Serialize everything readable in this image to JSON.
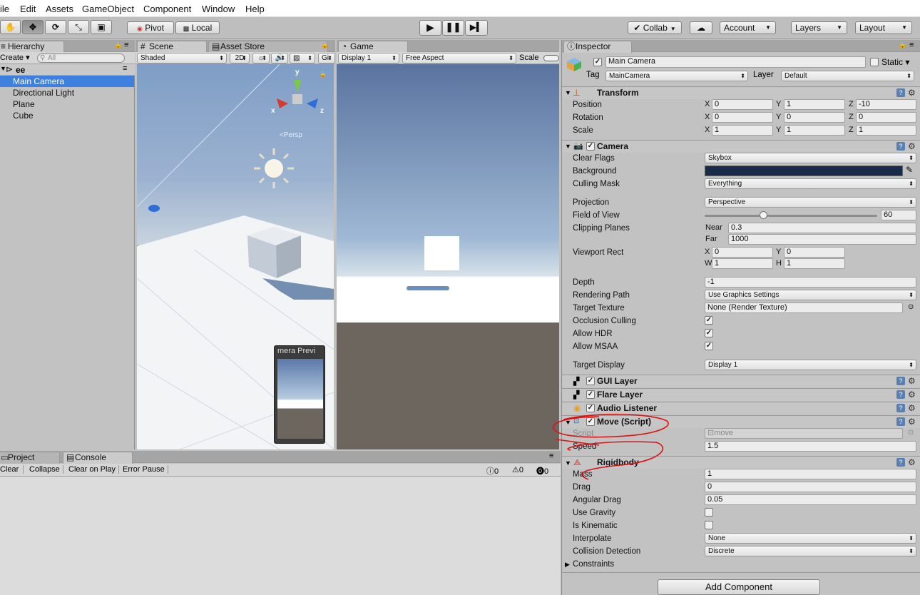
{
  "menu": [
    "ile",
    "Edit",
    "Assets",
    "GameObject",
    "Component",
    "Window",
    "Help"
  ],
  "toolbar": {
    "pivot_label": "Pivot",
    "local_label": "Local",
    "collab_label": "Collab",
    "account_label": "Account",
    "layers_label": "Layers",
    "layout_label": "Layout"
  },
  "hierarchy": {
    "tab_label": "Hierarchy",
    "create_label": "Create",
    "search_placeholder": "All",
    "scene_name": "ee",
    "items": [
      "Main Camera",
      "Directional Light",
      "Plane",
      "Cube"
    ]
  },
  "scene": {
    "tab_label": "Scene",
    "asset_store_label": "Asset Store",
    "shaded_label": "Shaded",
    "twod_label": "2D",
    "gizmos_label": "Gi",
    "persp_label": "Persp",
    "axis_x": "x",
    "axis_y": "y",
    "axis_z": "z",
    "camera_preview_label": "mera Previ"
  },
  "game": {
    "tab_label": "Game",
    "display_label": "Display 1",
    "aspect_label": "Free Aspect",
    "scale_label": "Scale"
  },
  "console": {
    "project_tab": "Project",
    "console_tab": "Console",
    "clear": "Clear",
    "collapse": "Collapse",
    "clear_on_play": "Clear on Play",
    "error_pause": "Error Pause",
    "info_count": "0",
    "warn_count": "0",
    "error_count": "0"
  },
  "inspector": {
    "tab_label": "Inspector",
    "object_name": "Main Camera",
    "static_label": "Static",
    "tag_label": "Tag",
    "tag_value": "MainCamera",
    "layer_label": "Layer",
    "layer_value": "Default",
    "transform": {
      "title": "Transform",
      "position_label": "Position",
      "rotation_label": "Rotation",
      "scale_label": "Scale",
      "position": [
        "0",
        "1",
        "-10"
      ],
      "rotation": [
        "0",
        "0",
        "0"
      ],
      "scale": [
        "1",
        "1",
        "1"
      ],
      "axis": [
        "X",
        "Y",
        "Z"
      ]
    },
    "camera": {
      "title": "Camera",
      "clear_flags_label": "Clear Flags",
      "clear_flags": "Skybox",
      "background_label": "Background",
      "background_color": "#1a2a4a",
      "culling_mask_label": "Culling Mask",
      "culling_mask": "Everything",
      "projection_label": "Projection",
      "projection": "Perspective",
      "fov_label": "Field of View",
      "fov": "60",
      "fov_fraction": 0.34,
      "clipping_label": "Clipping Planes",
      "near_label": "Near",
      "near": "0.3",
      "far_label": "Far",
      "far": "1000",
      "viewport_label": "Viewport Rect",
      "vx": "0",
      "vy": "0",
      "vw": "1",
      "vh": "1",
      "x_label": "X",
      "y_label": "Y",
      "w_label": "W",
      "h_label": "H",
      "depth_label": "Depth",
      "depth": "-1",
      "rendering_path_label": "Rendering Path",
      "rendering_path": "Use Graphics Settings",
      "target_texture_label": "Target Texture",
      "target_texture": "None (Render Texture)",
      "occlusion_label": "Occlusion Culling",
      "hdr_label": "Allow HDR",
      "msaa_label": "Allow MSAA",
      "target_display_label": "Target Display",
      "target_display": "Display 1"
    },
    "gui_layer": "GUI Layer",
    "flare_layer": "Flare Layer",
    "audio_listener": "Audio Listener",
    "move": {
      "title": "Move (Script)",
      "script_label": "Script",
      "script_value": "move",
      "speed_label": "Speed",
      "speed": "1.5"
    },
    "rigidbody": {
      "title": "Rigidbody",
      "mass_label": "Mass",
      "mass": "1",
      "drag_label": "Drag",
      "drag": "0",
      "angular_drag_label": "Angular Drag",
      "angular_drag": "0.05",
      "use_gravity_label": "Use Gravity",
      "is_kinematic_label": "Is Kinematic",
      "interpolate_label": "Interpolate",
      "interpolate": "None",
      "collision_label": "Collision Detection",
      "collision": "Discrete",
      "constraints_label": "Constraints"
    },
    "add_component": "Add Component"
  },
  "colors": {
    "selection": "#3d80df",
    "annotation_red": "#e01010"
  }
}
